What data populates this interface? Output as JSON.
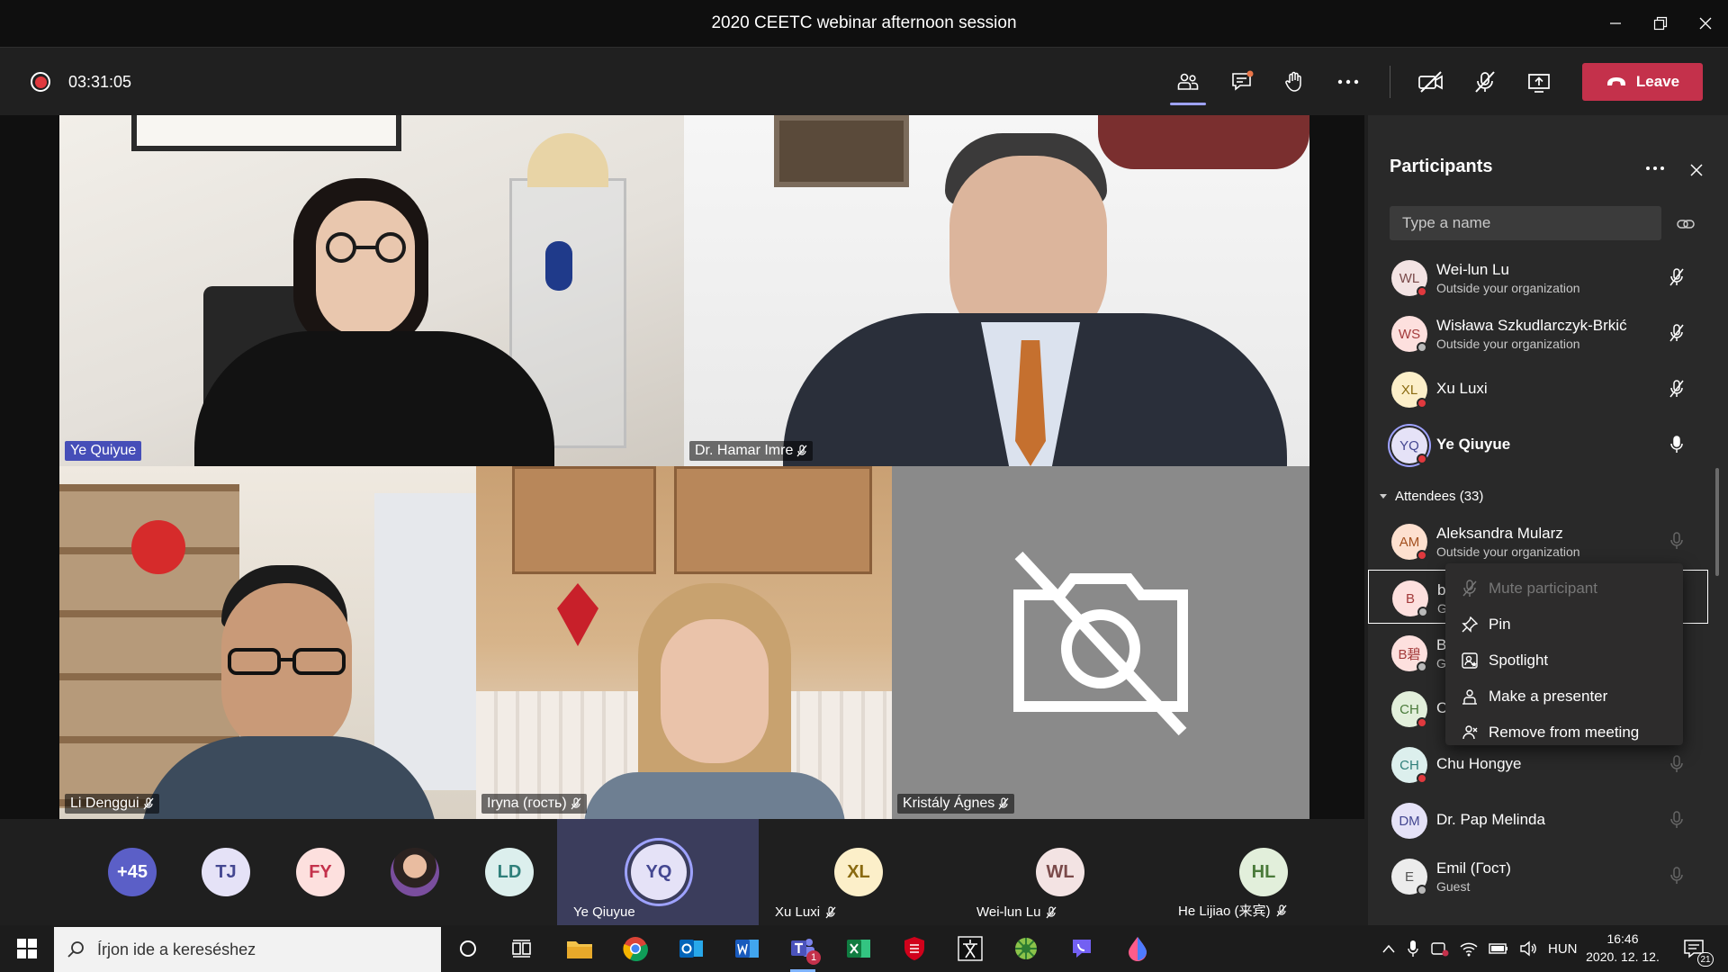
{
  "window": {
    "title": "2020 CEETC webinar afternoon session"
  },
  "toolbar": {
    "timer": "03:31:05",
    "leave_label": "Leave"
  },
  "stage": {
    "tiles": [
      {
        "name": "Ye Quiyue"
      },
      {
        "name": "Dr. Hamar Imre"
      },
      {
        "name": "Li Denggui"
      },
      {
        "name": "Iryna (гость)"
      },
      {
        "name": "Kristály Ágnes"
      }
    ]
  },
  "strip": {
    "overflow": "+45",
    "avatars": [
      "TJ",
      "FY",
      "LD"
    ],
    "tiles": [
      {
        "initials": "YQ",
        "name": "Ye Qiuyue"
      },
      {
        "initials": "XL",
        "name": "Xu Luxi"
      },
      {
        "initials": "WL",
        "name": "Wei-lun Lu"
      },
      {
        "initials": "HL",
        "name": "He Lijiao (来宾)"
      }
    ]
  },
  "panel": {
    "title": "Participants",
    "search_placeholder": "Type a name",
    "attendees_header": "Attendees (33)",
    "presenters": [
      {
        "initials": "WL",
        "name": "Wei-lun Lu",
        "sub": "Outside your organization"
      },
      {
        "initials": "WS",
        "name": "Wisława Szkudlarczyk-Brkić",
        "sub": "Outside your organization"
      },
      {
        "initials": "XL",
        "name": "Xu Luxi",
        "sub": ""
      },
      {
        "initials": "YQ",
        "name": "Ye Qiuyue",
        "sub": ""
      }
    ],
    "attendees": [
      {
        "initials": "AM",
        "name": "Aleksandra Mularz",
        "sub": "Outside your organization"
      },
      {
        "initials": "B",
        "name": "b",
        "sub": "G"
      },
      {
        "initials": "B碧",
        "name": "B",
        "sub": "G"
      },
      {
        "initials": "CH",
        "name": "C",
        "sub": ""
      },
      {
        "initials": "CH",
        "name": "Chu Hongye",
        "sub": ""
      },
      {
        "initials": "DM",
        "name": "Dr. Pap Melinda",
        "sub": ""
      },
      {
        "initials": "E",
        "name": "Emil (Гост)",
        "sub": "Guest"
      }
    ]
  },
  "context_menu": {
    "items": [
      {
        "label": "Mute participant"
      },
      {
        "label": "Pin"
      },
      {
        "label": "Spotlight"
      },
      {
        "label": "Make a presenter"
      },
      {
        "label": "Remove from meeting"
      }
    ]
  },
  "taskbar": {
    "search_placeholder": "Írjon ide a kereséshez",
    "teams_badge": "1",
    "language": "HUN",
    "time": "16:46",
    "date": "2020. 12. 12.",
    "notifications": "21"
  },
  "colors": {
    "leave": "#c4314b",
    "accent": "#9ea2ff",
    "status_busy": "#e0393e",
    "camera_off_bg": "#8a8a8a"
  }
}
